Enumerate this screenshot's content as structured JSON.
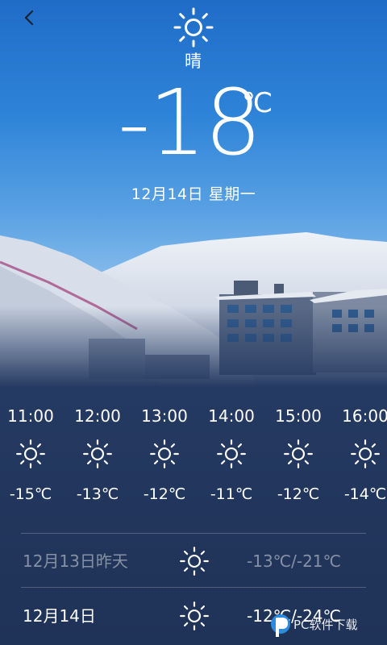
{
  "current": {
    "condition": "晴",
    "condition_icon": "sun-icon",
    "temperature": "-18",
    "unit": "℃",
    "date": "12月14日 星期一"
  },
  "hourly": [
    {
      "time": "11:00",
      "icon": "sun-icon",
      "temp": "-15℃"
    },
    {
      "time": "12:00",
      "icon": "sun-icon",
      "temp": "-13℃"
    },
    {
      "time": "13:00",
      "icon": "sun-icon",
      "temp": "-12℃"
    },
    {
      "time": "14:00",
      "icon": "sun-icon",
      "temp": "-11℃"
    },
    {
      "time": "15:00",
      "icon": "sun-icon",
      "temp": "-12℃"
    },
    {
      "time": "16:00",
      "icon": "sun-icon",
      "temp": "-14℃"
    }
  ],
  "daily": [
    {
      "date": "12月13日昨天",
      "icon": "sun-icon",
      "range": "-13℃/-21℃"
    },
    {
      "date": "12月14日",
      "icon": "sun-icon",
      "range": "-12℃/-24℃"
    }
  ],
  "watermark": {
    "text": "PC软件下载"
  },
  "colors": {
    "sky_top": "#1f6cc7",
    "panel": "#253a62",
    "text": "#ffffff"
  }
}
